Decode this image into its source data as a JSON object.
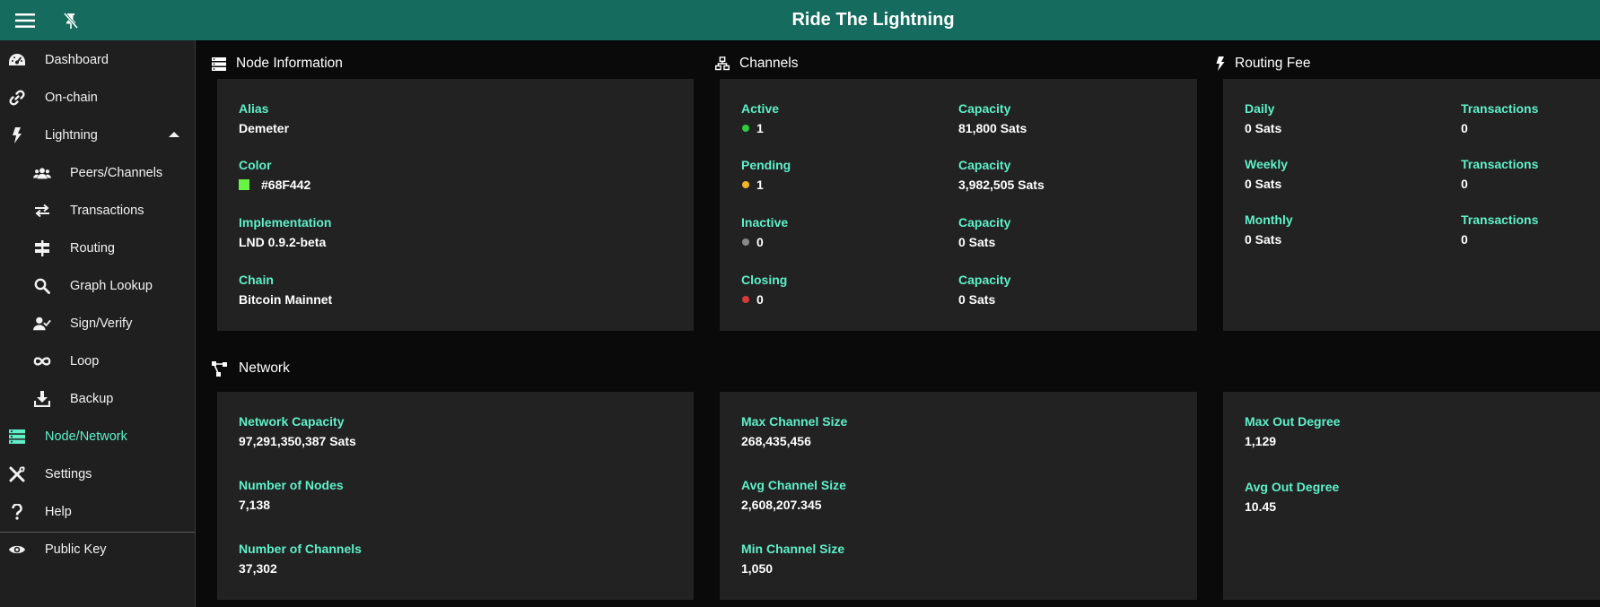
{
  "app": {
    "title": "Ride The Lightning"
  },
  "colors": {
    "topbar": "#156b5e",
    "accent": "#5ff0c8",
    "node_color": "#68F442",
    "active_dot": "#2ecc40",
    "pending_dot": "#f0b429",
    "inactive_dot": "#8a8a8a",
    "closing_dot": "#d63b3b"
  },
  "sidebar": {
    "items": [
      {
        "label": "Dashboard",
        "icon": "dashboard-icon"
      },
      {
        "label": "On-chain",
        "icon": "link-icon"
      },
      {
        "label": "Lightning",
        "icon": "bolt-icon",
        "expanded": true
      },
      {
        "label": "Peers/Channels",
        "icon": "people-icon"
      },
      {
        "label": "Transactions",
        "icon": "swap-icon"
      },
      {
        "label": "Routing",
        "icon": "signpost-icon"
      },
      {
        "label": "Graph Lookup",
        "icon": "search-icon"
      },
      {
        "label": "Sign/Verify",
        "icon": "user-check-icon"
      },
      {
        "label": "Loop",
        "icon": "infinity-icon"
      },
      {
        "label": "Backup",
        "icon": "download-icon"
      },
      {
        "label": "Node/Network",
        "icon": "server-icon",
        "active": true
      },
      {
        "label": "Settings",
        "icon": "tools-icon"
      },
      {
        "label": "Help",
        "icon": "question-icon"
      },
      {
        "label": "Public Key",
        "icon": "eye-icon"
      }
    ]
  },
  "node_info": {
    "title": "Node Information",
    "alias_label": "Alias",
    "alias": "Demeter",
    "color_label": "Color",
    "color": "#68F442",
    "impl_label": "Implementation",
    "impl": "LND 0.9.2-beta",
    "chain_label": "Chain",
    "chain": "Bitcoin Mainnet"
  },
  "channels": {
    "title": "Channels",
    "active_label": "Active",
    "active": "1",
    "active_cap_label": "Capacity",
    "active_cap": "81,800 Sats",
    "pending_label": "Pending",
    "pending": "1",
    "pending_cap_label": "Capacity",
    "pending_cap": "3,982,505 Sats",
    "inactive_label": "Inactive",
    "inactive": "0",
    "inactive_cap_label": "Capacity",
    "inactive_cap": "0 Sats",
    "closing_label": "Closing",
    "closing": "0",
    "closing_cap_label": "Capacity",
    "closing_cap": "0 Sats"
  },
  "routing_fee": {
    "title": "Routing Fee",
    "daily_label": "Daily",
    "daily": "0 Sats",
    "daily_tx_label": "Transactions",
    "daily_tx": "0",
    "weekly_label": "Weekly",
    "weekly": "0 Sats",
    "weekly_tx_label": "Transactions",
    "weekly_tx": "0",
    "monthly_label": "Monthly",
    "monthly": "0 Sats",
    "monthly_tx_label": "Transactions",
    "monthly_tx": "0"
  },
  "network": {
    "title": "Network",
    "capacity_label": "Network Capacity",
    "capacity": "97,291,350,387 Sats",
    "nodes_label": "Number of Nodes",
    "nodes": "7,138",
    "channels_label": "Number of Channels",
    "channels": "37,302",
    "max_size_label": "Max Channel Size",
    "max_size": "268,435,456",
    "avg_size_label": "Avg Channel Size",
    "avg_size": "2,608,207.345",
    "min_size_label": "Min Channel Size",
    "min_size": "1,050",
    "max_out_label": "Max Out Degree",
    "max_out": "1,129",
    "avg_out_label": "Avg Out Degree",
    "avg_out": "10.45"
  }
}
